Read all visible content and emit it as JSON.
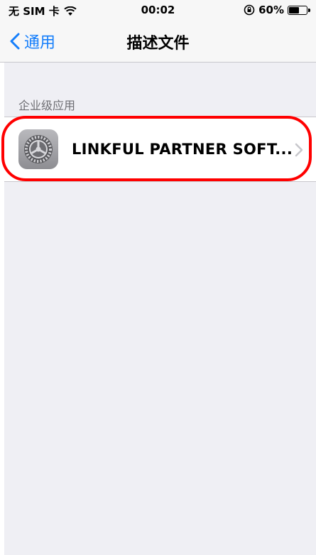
{
  "status_bar": {
    "carrier": "无 SIM 卡",
    "time": "00:02",
    "battery": "60%",
    "battery_level": 0.6
  },
  "nav": {
    "back_label": "通用",
    "title": "描述文件"
  },
  "section": {
    "header": "企业级应用",
    "items": [
      {
        "label": "LINKFUL PARTNER SOFT...",
        "icon": "settings-gear-icon"
      }
    ]
  },
  "colors": {
    "accent": "#147efb",
    "background": "#efeff4",
    "highlight": "#ff0000"
  }
}
